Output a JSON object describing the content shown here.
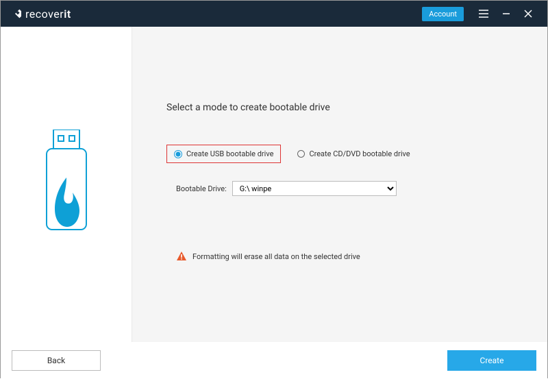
{
  "titlebar": {
    "brand_prefix": "recover",
    "brand_suffix": "it",
    "account_label": "Account"
  },
  "content": {
    "heading": "Select a mode to create bootable drive",
    "option_usb": "Create USB bootable drive",
    "option_cd": "Create CD/DVD bootable drive",
    "drive_label": "Bootable Drive:",
    "drive_value": "G:\\ winpe",
    "warning_text": "Formatting will erase all data on the selected drive"
  },
  "footer": {
    "back_label": "Back",
    "create_label": "Create"
  }
}
